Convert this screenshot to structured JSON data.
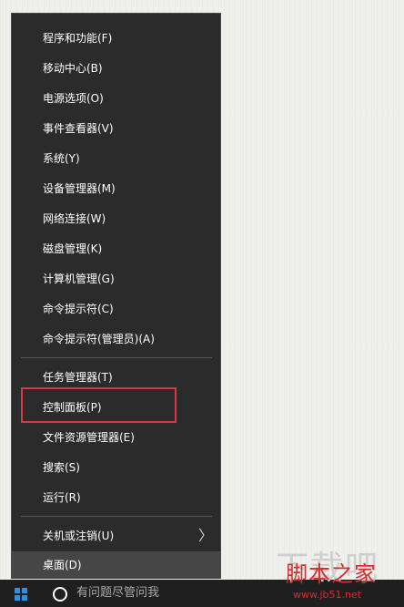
{
  "menu": {
    "items": [
      {
        "label": "程序和功能(F)"
      },
      {
        "label": "移动中心(B)"
      },
      {
        "label": "电源选项(O)"
      },
      {
        "label": "事件查看器(V)"
      },
      {
        "label": "系统(Y)"
      },
      {
        "label": "设备管理器(M)"
      },
      {
        "label": "网络连接(W)"
      },
      {
        "label": "磁盘管理(K)"
      },
      {
        "label": "计算机管理(G)"
      },
      {
        "label": "命令提示符(C)"
      },
      {
        "label": "命令提示符(管理员)(A)"
      },
      {
        "label": "任务管理器(T)"
      },
      {
        "label": "控制面板(P)"
      },
      {
        "label": "文件资源管理器(E)"
      },
      {
        "label": "搜索(S)"
      },
      {
        "label": "运行(R)"
      },
      {
        "label": "关机或注销(U)",
        "has_submenu": true
      },
      {
        "label": "桌面(D)"
      }
    ],
    "highlighted_item": "控制面板(P)",
    "highlight_color": "#d9383e",
    "chevron_glyph": "〉"
  },
  "taskbar": {
    "search_text": "有问题尽管问我",
    "start_icon": "windows-logo-icon",
    "cortana_icon": "cortana-circle-icon"
  },
  "watermark": {
    "brand_text": "脚本之家",
    "url": "www.jb51.net",
    "faded_text": "下载吧"
  }
}
